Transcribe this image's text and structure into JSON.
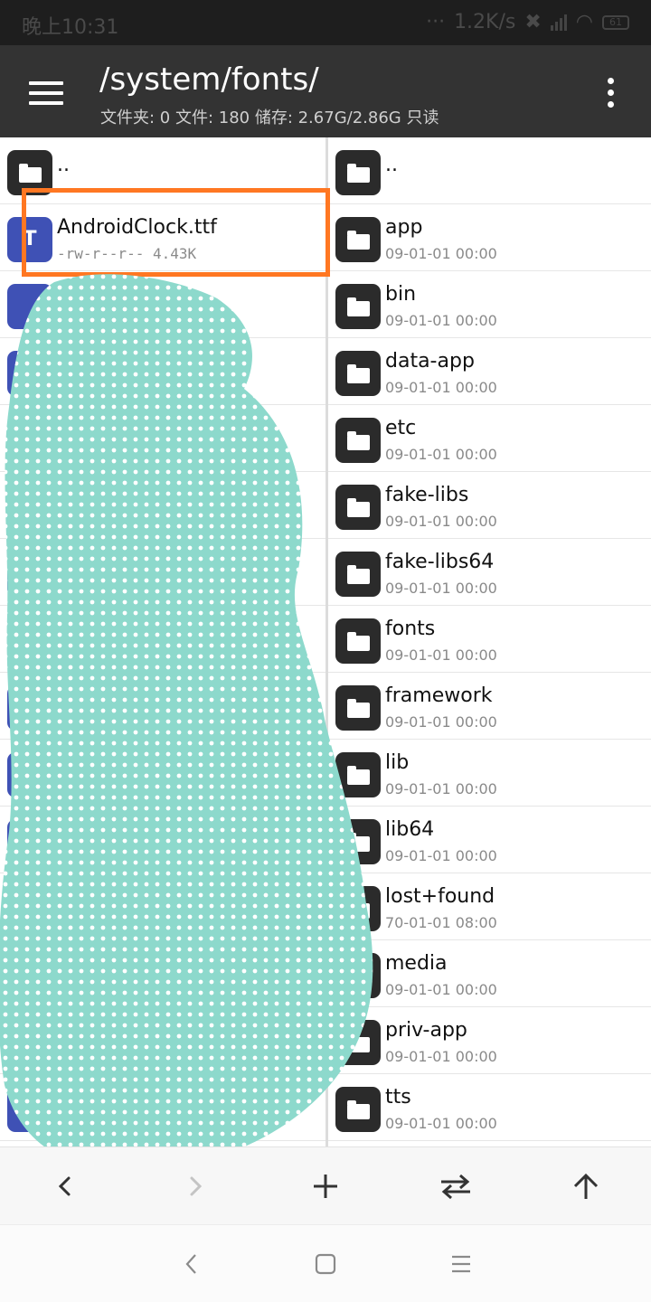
{
  "status_bar": {
    "time": "晚上10:31",
    "speed": "1.2K/s",
    "battery": "61"
  },
  "header": {
    "path": "/system/fonts/",
    "info": "文件夹: 0  文件: 180  储存: 2.67G/2.86G  只读"
  },
  "left_pane": {
    "parent": "..",
    "files": [
      {
        "name": "AndroidClock.ttf",
        "icon_letter": "T",
        "perms": "-rw-r--r--",
        "size": "4.43K"
      }
    ]
  },
  "right_pane": {
    "parent": "..",
    "folders": [
      {
        "name": "app",
        "date": "09-01-01 00:00"
      },
      {
        "name": "bin",
        "date": "09-01-01 00:00"
      },
      {
        "name": "data-app",
        "date": "09-01-01 00:00"
      },
      {
        "name": "etc",
        "date": "09-01-01 00:00"
      },
      {
        "name": "fake-libs",
        "date": "09-01-01 00:00"
      },
      {
        "name": "fake-libs64",
        "date": "09-01-01 00:00"
      },
      {
        "name": "fonts",
        "date": "09-01-01 00:00"
      },
      {
        "name": "framework",
        "date": "09-01-01 00:00"
      },
      {
        "name": "lib",
        "date": "09-01-01 00:00"
      },
      {
        "name": "lib64",
        "date": "09-01-01 00:00"
      },
      {
        "name": "lost+found",
        "date": "70-01-01 08:00"
      },
      {
        "name": "media",
        "date": "09-01-01 00:00"
      },
      {
        "name": "priv-app",
        "date": "09-01-01 00:00"
      },
      {
        "name": "tts",
        "date": "09-01-01 00:00"
      }
    ]
  },
  "toolbar": {
    "buttons": [
      {
        "icon": "back-arrow-icon",
        "enabled": true
      },
      {
        "icon": "forward-arrow-icon",
        "enabled": false
      },
      {
        "icon": "add-icon",
        "enabled": true
      },
      {
        "icon": "swap-icon",
        "enabled": true
      },
      {
        "icon": "up-arrow-icon",
        "enabled": true
      }
    ]
  },
  "colors": {
    "appbar": "#333333",
    "highlight": "#ff7722",
    "font_icon": "#3f51b5",
    "overlay": "#8dd9cc"
  }
}
